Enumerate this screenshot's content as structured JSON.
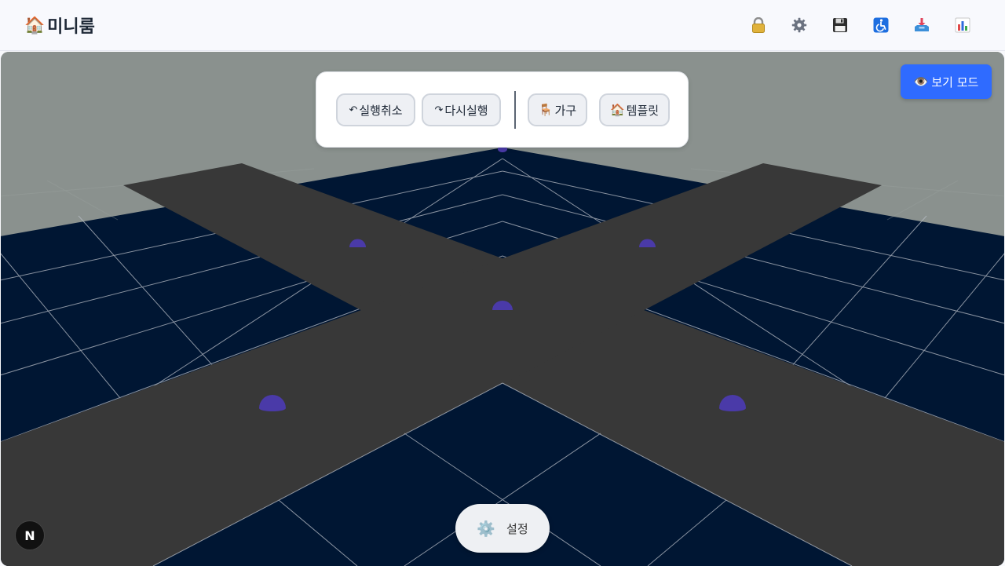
{
  "app": {
    "logo_icon": "house-emoji",
    "logo_glyph": "🏠",
    "title": "미니룸"
  },
  "header_icons": [
    {
      "name": "lock-icon",
      "glyph": "🔒"
    },
    {
      "name": "gear-icon",
      "glyph": "⚙️"
    },
    {
      "name": "save-icon",
      "glyph": "💾"
    },
    {
      "name": "accessibility-icon",
      "glyph": "♿"
    },
    {
      "name": "inbox-tray-icon",
      "glyph": "📥"
    },
    {
      "name": "bar-chart-icon",
      "glyph": "📊"
    }
  ],
  "edit_toolbar": {
    "undo": {
      "glyph": "↶",
      "label": "실행취소"
    },
    "redo": {
      "glyph": "↷",
      "label": "다시실행"
    },
    "furniture": {
      "glyph": "🪑",
      "label": "가구"
    },
    "template": {
      "glyph": "🏠",
      "label": "템플릿"
    }
  },
  "view_mode": {
    "glyph": "👁️",
    "label": "보기 모드"
  },
  "settings": {
    "glyph": "⚙️",
    "label": "설정"
  },
  "framework_badge": {
    "letter": "N"
  },
  "colors": {
    "accent": "#2f6bff",
    "floor_tile": "#001633",
    "path": "#383838",
    "marker": "#4a3aa8",
    "wall": "#8a918e"
  }
}
